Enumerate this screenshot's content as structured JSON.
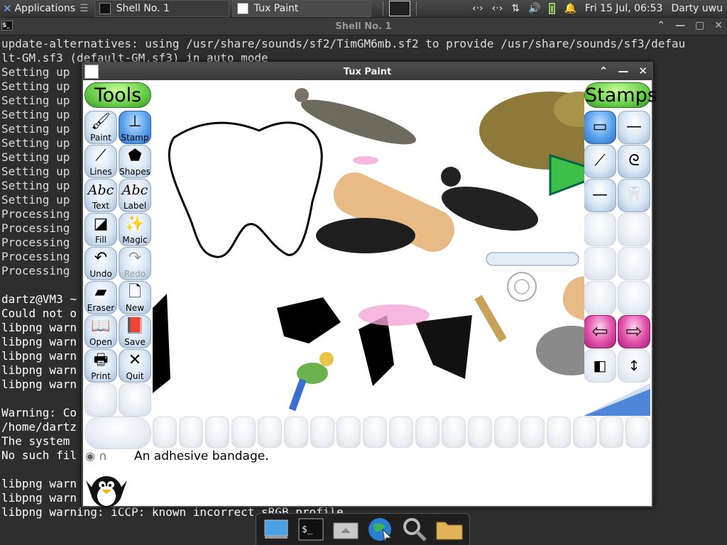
{
  "top_panel": {
    "apps_label": "Applications",
    "tasks": [
      {
        "label": "Shell No. 1"
      },
      {
        "label": "Tux Paint"
      }
    ],
    "datetime": "Fri 15 Jul, 06:53",
    "user": "Darty uwu"
  },
  "terminal": {
    "title": "Shell No. 1",
    "lines": [
      "update-alternatives: using /usr/share/sounds/sf2/TimGM6mb.sf2 to provide /usr/share/sounds/sf3/defau",
      "lt-GM.sf3 (default-GM.sf3) in auto mode",
      "Setting up",
      "Setting up",
      "Setting up",
      "Setting up",
      "Setting up",
      "Setting up",
      "Setting up",
      "Setting up",
      "Setting up",
      "Setting up",
      "Processing",
      "Processing",
      "Processing",
      "Processing",
      "Processing",
      "",
      "dartz@VM3 ~",
      "Could not o",
      "libpng warn",
      "libpng warn",
      "libpng warn",
      "libpng warn",
      "libpng warn",
      "",
      "Warning: Co",
      "/home/dartz",
      "The system",
      "No such fil",
      "",
      "libpng warn",
      "libpng warn",
      "libpng warning: iCCP: known incorrect sRGB profile",
      ""
    ]
  },
  "tuxpaint": {
    "title": "Tux Paint",
    "tools_header": "Tools",
    "stamps_header": "Stamps",
    "tools": [
      {
        "label": "Paint",
        "icon": "paint-brush-icon",
        "glyph": "🖌",
        "selected": false,
        "disabled": false
      },
      {
        "label": "Stamp",
        "icon": "stamp-icon",
        "glyph": "⊥",
        "selected": true,
        "disabled": false
      },
      {
        "label": "Lines",
        "icon": "lines-icon",
        "glyph": "⟋",
        "selected": false,
        "disabled": false
      },
      {
        "label": "Shapes",
        "icon": "pentagon-icon",
        "glyph": "⬟",
        "selected": false,
        "disabled": false
      },
      {
        "label": "Text",
        "icon": "text-icon",
        "glyph": "Abc",
        "selected": false,
        "disabled": false
      },
      {
        "label": "Label",
        "icon": "label-icon",
        "glyph": "Abc",
        "selected": false,
        "disabled": false
      },
      {
        "label": "Fill",
        "icon": "fill-bucket-icon",
        "glyph": "◪",
        "selected": false,
        "disabled": false
      },
      {
        "label": "Magic",
        "icon": "magic-wand-icon",
        "glyph": "✨",
        "selected": false,
        "disabled": false
      },
      {
        "label": "Undo",
        "icon": "undo-icon",
        "glyph": "↶",
        "selected": false,
        "disabled": false
      },
      {
        "label": "Redo",
        "icon": "redo-icon",
        "glyph": "↷",
        "selected": false,
        "disabled": true
      },
      {
        "label": "Eraser",
        "icon": "eraser-icon",
        "glyph": "▰",
        "selected": false,
        "disabled": false
      },
      {
        "label": "New",
        "icon": "new-page-icon",
        "glyph": "🗋",
        "selected": false,
        "disabled": false
      },
      {
        "label": "Open",
        "icon": "open-book-icon",
        "glyph": "📖",
        "selected": false,
        "disabled": false
      },
      {
        "label": "Save",
        "icon": "save-book-icon",
        "glyph": "📕",
        "selected": false,
        "disabled": false
      },
      {
        "label": "Print",
        "icon": "printer-icon",
        "glyph": "🖶",
        "selected": false,
        "disabled": false
      },
      {
        "label": "Quit",
        "icon": "quit-icon",
        "glyph": "✕",
        "selected": false,
        "disabled": false
      }
    ],
    "stamps": [
      {
        "name": "stamp-bandage",
        "icon": "bandage-icon",
        "glyph": "▭",
        "selected": true
      },
      {
        "name": "stamp-thermometer",
        "icon": "thermometer-icon",
        "glyph": "—",
        "selected": false
      },
      {
        "name": "stamp-syringe",
        "icon": "syringe-icon",
        "glyph": "⟋",
        "selected": false
      },
      {
        "name": "stamp-stethoscope",
        "icon": "stethoscope-icon",
        "glyph": "ᘓ",
        "selected": false
      },
      {
        "name": "stamp-needle",
        "icon": "needle-icon",
        "glyph": "—",
        "selected": false
      },
      {
        "name": "stamp-tooth",
        "icon": "tooth-icon",
        "glyph": "🦷",
        "selected": false
      }
    ],
    "status_text": "An adhesive bandage.",
    "colors": {
      "selected_tool": "#3c8de0",
      "header_green": "#58c43c",
      "nav_pink": "#e050a8"
    }
  },
  "dock": {
    "items": [
      {
        "name": "dock-desktop",
        "icon": "desktop-icon"
      },
      {
        "name": "dock-terminal",
        "icon": "terminal-icon"
      },
      {
        "name": "dock-home",
        "icon": "home-folder-icon"
      },
      {
        "name": "dock-browser",
        "icon": "globe-icon"
      },
      {
        "name": "dock-search",
        "icon": "magnifier-icon"
      },
      {
        "name": "dock-files",
        "icon": "folder-icon"
      }
    ]
  }
}
